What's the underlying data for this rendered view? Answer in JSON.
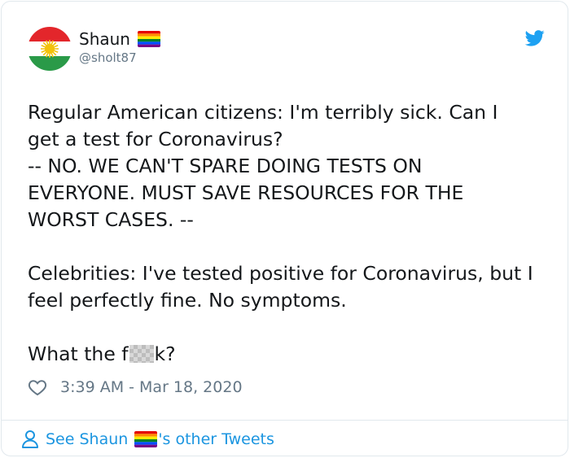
{
  "colors": {
    "text": "#14171a",
    "secondary": "#657786",
    "link": "#1b95e0",
    "border": "#e1e8ed",
    "twitter_blue": "#1da1f2"
  },
  "tweet": {
    "author": {
      "display_name": "Shaun",
      "handle": "@sholt87",
      "avatar_icon": "kurdistan-flag-avatar",
      "badge_icon": "rainbow-flag-icon"
    },
    "text_lines": [
      "Regular American citizens: I'm terribly sick. Can I",
      "get a test for Coronavirus?",
      "-- NO. WE CAN'T SPARE DOING TESTS ON",
      "EVERYONE. MUST SAVE RESOURCES FOR THE",
      "WORST CASES. --",
      "",
      "Celebrities: I've tested positive for Coronavirus, but I",
      "feel perfectly fine. No symptoms.",
      ""
    ],
    "last_line_start": "What the f",
    "last_line_end": "k?",
    "timestamp": "3:39 AM - Mar 18, 2020",
    "brand_icon": "twitter-bird-icon",
    "like_icon": "heart-icon"
  },
  "footer": {
    "link_prefix": "See Shaun",
    "link_suffix": "'s other Tweets",
    "icon": "person-icon"
  }
}
